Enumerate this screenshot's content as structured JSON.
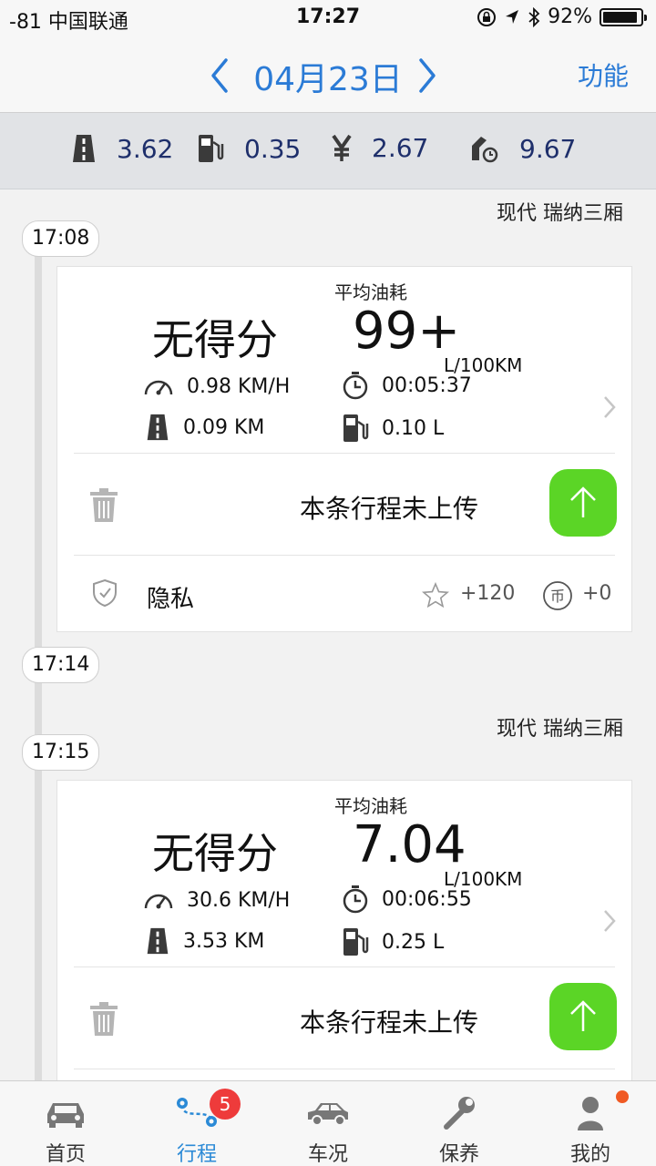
{
  "status_bar": {
    "carrier": "-81 中国联通",
    "time": "17:27",
    "battery": "92%"
  },
  "header": {
    "date": "04月23日",
    "function_label": "功能"
  },
  "summary": {
    "distance": "3.62",
    "fuel": "0.35",
    "cost": "2.67",
    "consumption": "9.67"
  },
  "groups": [
    {
      "car": "现代 瑞纳三厢",
      "time": "17:08"
    },
    {
      "time": "17:14"
    },
    {
      "car": "现代 瑞纳三厢",
      "time": "17:15"
    }
  ],
  "trips": [
    {
      "avg_label": "平均油耗",
      "score": "无得分",
      "avg_value": "99+",
      "unit": "L/100KM",
      "speed": "0.98 KM/H",
      "duration": "00:05:37",
      "distance": "0.09 KM",
      "fuel": "0.10 L",
      "upload_text": "本条行程未上传",
      "privacy": "隐私",
      "points": "+120",
      "coins": "+0"
    },
    {
      "avg_label": "平均油耗",
      "score": "无得分",
      "avg_value": "7.04",
      "unit": "L/100KM",
      "speed": "30.6 KM/H",
      "duration": "00:06:55",
      "distance": "3.53 KM",
      "fuel": "0.25 L",
      "upload_text": "本条行程未上传"
    }
  ],
  "tabs": [
    {
      "label": "首页",
      "icon": "car-front-icon"
    },
    {
      "label": "行程",
      "icon": "route-icon",
      "badge": "5",
      "active": true
    },
    {
      "label": "车况",
      "icon": "car-side-icon"
    },
    {
      "label": "保养",
      "icon": "wrench-icon"
    },
    {
      "label": "我的",
      "icon": "user-icon"
    }
  ],
  "colors": {
    "accent": "#2b7bd6",
    "upload": "#5bd526",
    "badge": "#ee3b3b",
    "summary_text": "#1e2f6b"
  }
}
